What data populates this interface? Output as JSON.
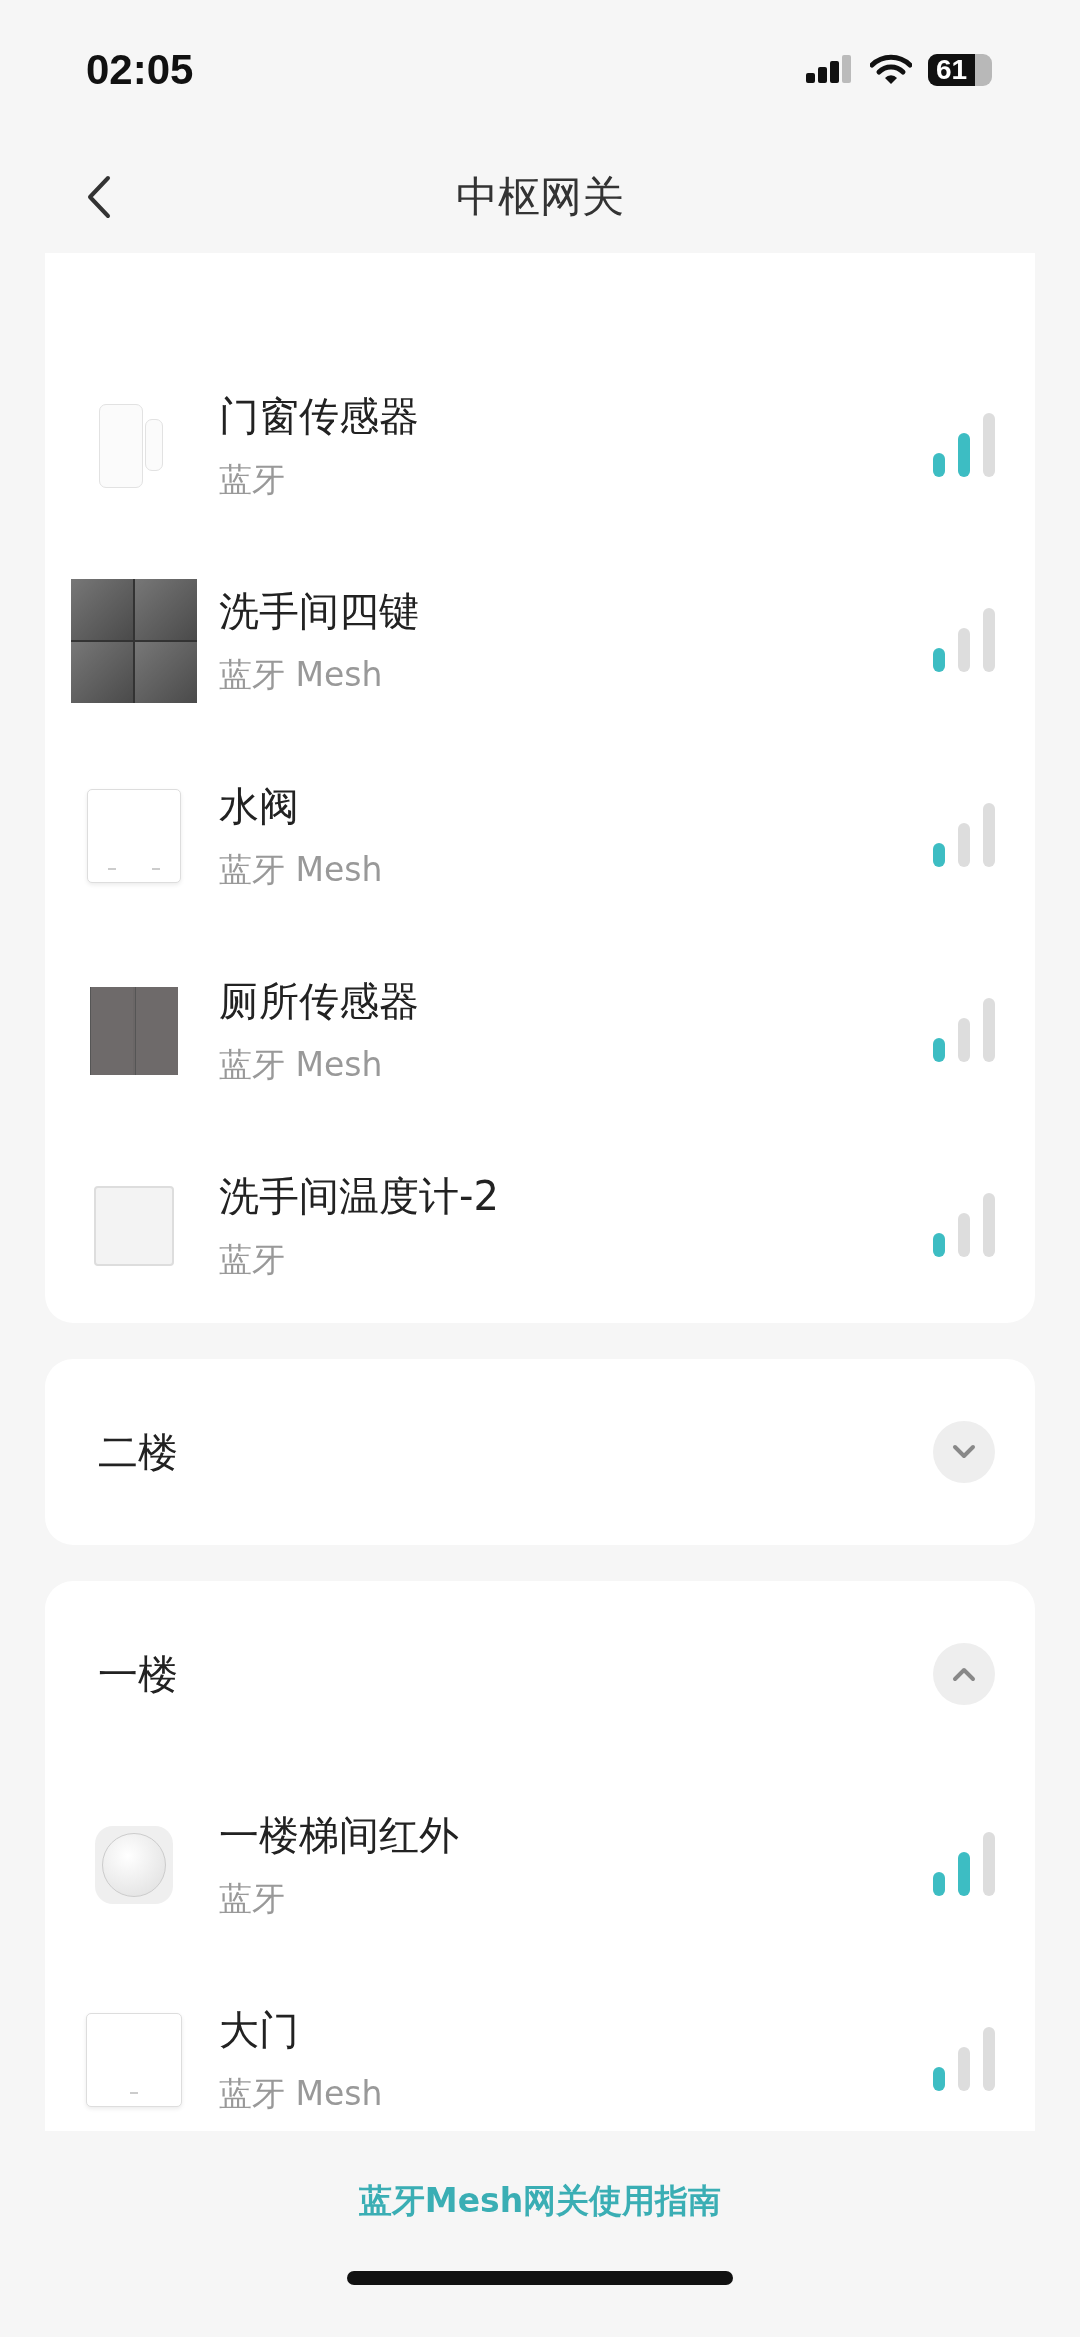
{
  "status_bar": {
    "time": "02:05",
    "battery": "61"
  },
  "header": {
    "title": "中枢网关"
  },
  "sections": [
    {
      "devices": [
        {
          "name": "门窗传感器",
          "protocol": "蓝牙",
          "kind": "door-sensor",
          "strong_signal": true
        },
        {
          "name": "洗手间四键",
          "protocol": "蓝牙 Mesh",
          "kind": "quad-switch",
          "strong_signal": false
        },
        {
          "name": "水阀",
          "protocol": "蓝牙 Mesh",
          "kind": "white-switch",
          "strong_signal": false
        },
        {
          "name": "厕所传感器",
          "protocol": "蓝牙 Mesh",
          "kind": "gray-switch",
          "strong_signal": false
        },
        {
          "name": "洗手间温度计-2",
          "protocol": "蓝牙",
          "kind": "square-sensor",
          "strong_signal": false
        }
      ]
    },
    {
      "title": "二楼",
      "expanded": false
    },
    {
      "title": "一楼",
      "expanded": true,
      "devices": [
        {
          "name": "一楼梯间红外",
          "protocol": "蓝牙",
          "kind": "round-sensor",
          "strong_signal": true
        },
        {
          "name": "大门",
          "protocol": "蓝牙 Mesh",
          "kind": "single-switch",
          "strong_signal": false
        }
      ]
    }
  ],
  "footer_link": "蓝牙Mesh网关使用指南"
}
